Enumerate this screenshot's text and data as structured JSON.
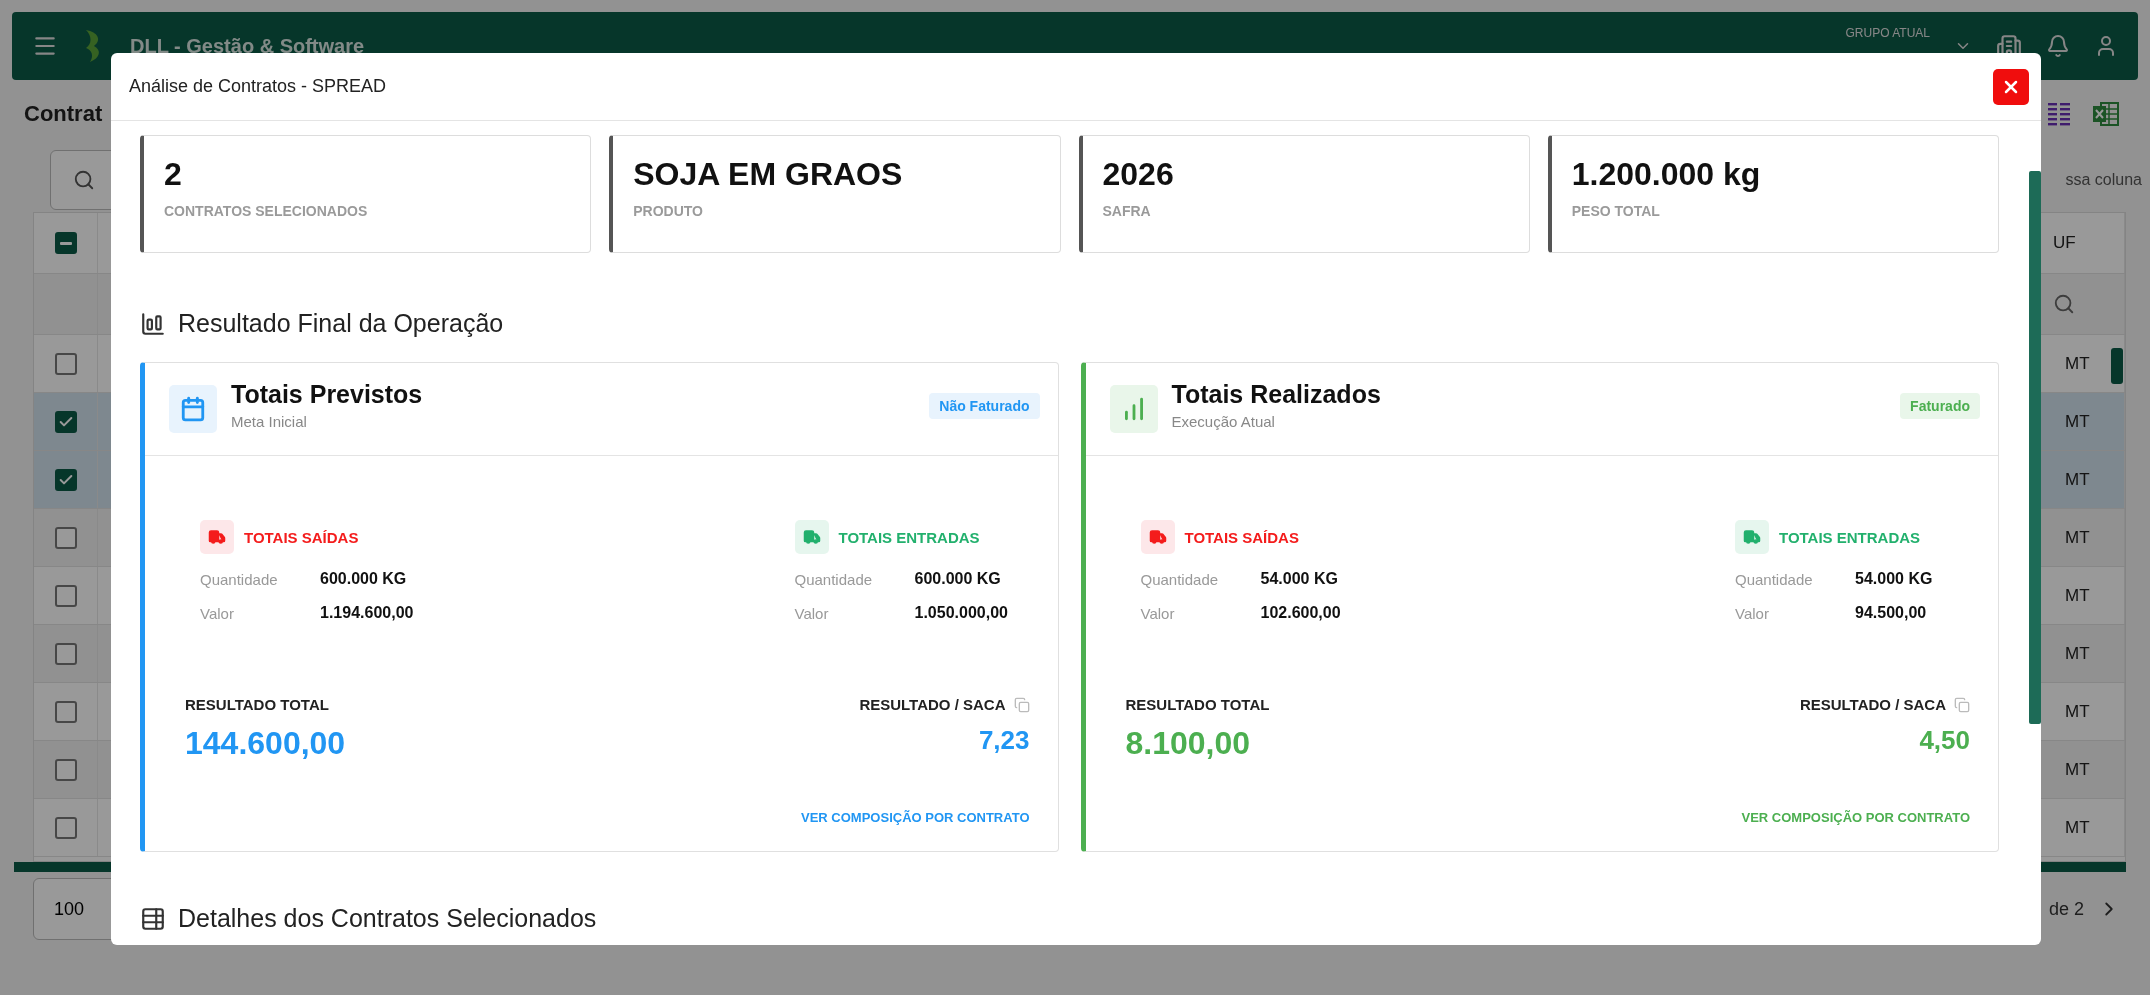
{
  "app_bar": {
    "title": "DLL - Gestão & Software",
    "group_label": "GRUPO ATUAL"
  },
  "page": {
    "title": "Contrat",
    "filter_hint": "ssa coluna",
    "uf_heading": "UF",
    "header_checkbox": {
      "indeterminate": true
    },
    "rows": [
      {
        "selected": false,
        "uf": "MT"
      },
      {
        "selected": true,
        "uf": "MT"
      },
      {
        "selected": true,
        "uf": "MT"
      },
      {
        "selected": false,
        "uf": "MT"
      },
      {
        "selected": false,
        "uf": "MT"
      },
      {
        "selected": false,
        "uf": "MT"
      },
      {
        "selected": false,
        "uf": "MT"
      },
      {
        "selected": false,
        "uf": "MT"
      },
      {
        "selected": false,
        "uf": "MT"
      }
    ],
    "page_size": "100",
    "page_total": "de 2"
  },
  "modal": {
    "title": "Análise de Contratos - SPREAD",
    "summary": [
      {
        "value": "2",
        "label": "CONTRATOS SELECIONADOS"
      },
      {
        "value": "SOJA EM GRAOS",
        "label": "PRODUTO"
      },
      {
        "value": "2026",
        "label": "SAFRA"
      },
      {
        "value": "1.200.000 kg",
        "label": "PESO TOTAL"
      }
    ],
    "section_title": "Resultado Final da Operação",
    "panels": [
      {
        "kind": "planned",
        "color": "#2196f3",
        "title": "Totais Previstos",
        "subtitle": "Meta Inicial",
        "badge": "Não Faturado",
        "flows": [
          {
            "kind": "out",
            "title": "TOTAIS SAÍDAS",
            "rows": [
              {
                "label": "Quantidade",
                "value": "600.000 KG"
              },
              {
                "label": "Valor",
                "value": "1.194.600,00"
              }
            ]
          },
          {
            "kind": "in",
            "title": "TOTAIS ENTRADAS",
            "rows": [
              {
                "label": "Quantidade",
                "value": "600.000 KG"
              },
              {
                "label": "Valor",
                "value": "1.050.000,00"
              }
            ]
          }
        ],
        "result_label": "RESULTADO TOTAL",
        "result_value": "144.600,00",
        "per_sack_label": "RESULTADO / SACA",
        "per_sack_value": "7,23",
        "link": "VER COMPOSIÇÃO POR CONTRATO"
      },
      {
        "kind": "realized",
        "color": "#4caf50",
        "title": "Totais Realizados",
        "subtitle": "Execução Atual",
        "badge": "Faturado",
        "flows": [
          {
            "kind": "out",
            "title": "TOTAIS SAÍDAS",
            "rows": [
              {
                "label": "Quantidade",
                "value": "54.000 KG"
              },
              {
                "label": "Valor",
                "value": "102.600,00"
              }
            ]
          },
          {
            "kind": "in",
            "title": "TOTAIS ENTRADAS",
            "rows": [
              {
                "label": "Quantidade",
                "value": "54.000 KG"
              },
              {
                "label": "Valor",
                "value": "94.500,00"
              }
            ]
          }
        ],
        "result_label": "RESULTADO TOTAL",
        "result_value": "8.100,00",
        "per_sack_label": "RESULTADO / SACA",
        "per_sack_value": "4,50",
        "link": "VER COMPOSIÇÃO POR CONTRATO"
      }
    ],
    "details_title": "Detalhes dos Contratos Selecionados"
  }
}
